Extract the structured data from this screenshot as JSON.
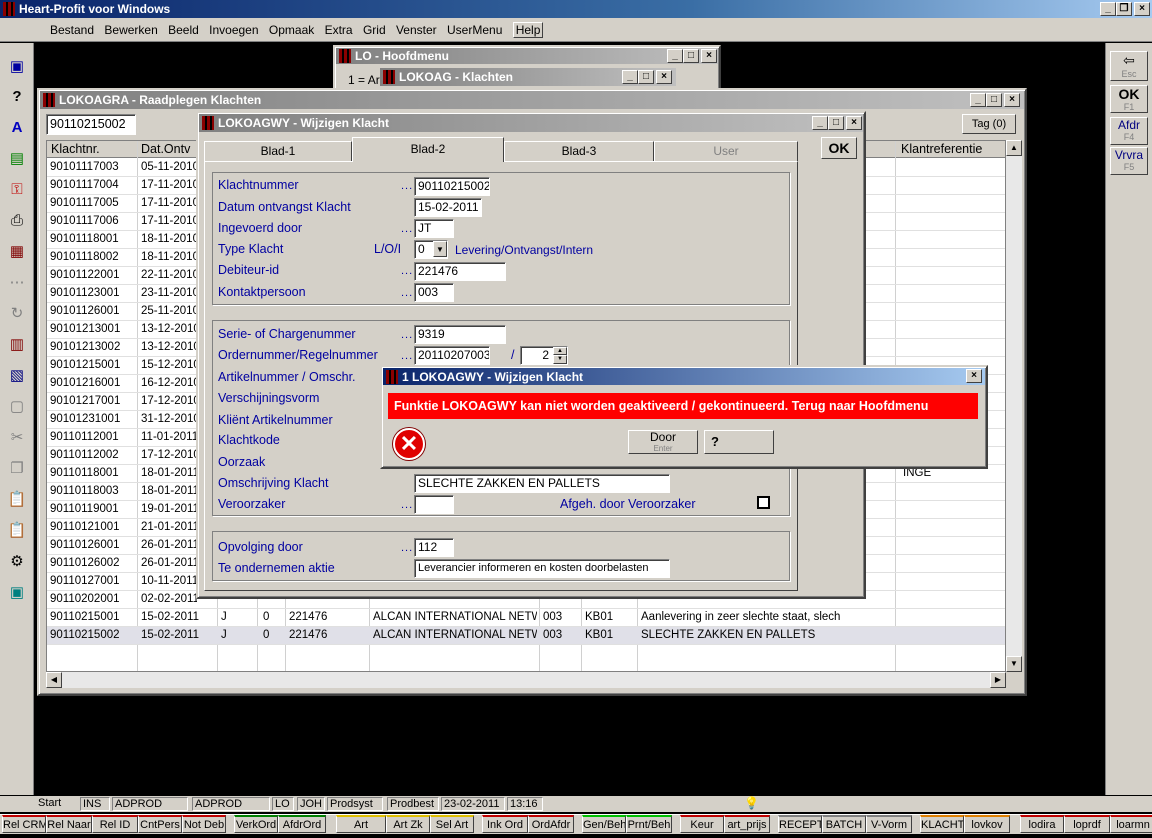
{
  "app": {
    "title": "Heart-Profit voor Windows"
  },
  "menu": [
    "Bestand",
    "Bewerken",
    "Beeld",
    "Invoegen",
    "Opmaak",
    "Extra",
    "Grid",
    "Venster",
    "UserMenu",
    "Help"
  ],
  "right_toolbar": {
    "esc": "Esc",
    "ok": "OK",
    "ok_key": "F1",
    "afdr": "Afdr",
    "afdr_key": "F4",
    "vrvra": "Vrvra",
    "vrvra_key": "F5"
  },
  "hoofdmenu": {
    "title": "LO - Hoofdmenu",
    "line": "1 = Ar"
  },
  "klachten_win": {
    "title": "LOKOAG - Klachten"
  },
  "raadplegen": {
    "title": "LOKOAGRA - Raadplegen Klachten",
    "search_value": "90110215002",
    "tag_button": "Tag (0)",
    "columns": [
      "Klachtnr.",
      "Dat.Ontv",
      "Klantreferentie"
    ],
    "rows": [
      [
        "90101117003",
        "05-11-2010"
      ],
      [
        "90101117004",
        "17-11-2010"
      ],
      [
        "90101117005",
        "17-11-2010"
      ],
      [
        "90101117006",
        "17-11-2010"
      ],
      [
        "90101118001",
        "18-11-2010"
      ],
      [
        "90101118002",
        "18-11-2010"
      ],
      [
        "90101122001",
        "22-11-2010"
      ],
      [
        "90101123001",
        "23-11-2010"
      ],
      [
        "90101126001",
        "25-11-2010"
      ],
      [
        "90101213001",
        "13-12-2010"
      ],
      [
        "90101213002",
        "13-12-2010"
      ],
      [
        "90101215001",
        "15-12-2010"
      ],
      [
        "90101216001",
        "16-12-2010"
      ],
      [
        "90101217001",
        "17-12-2010"
      ],
      [
        "90101231001",
        "31-12-2010"
      ],
      [
        "90110112001",
        "11-01-2011"
      ],
      [
        "90110112002",
        "17-12-2010"
      ],
      [
        "90110118001",
        "18-01-2011"
      ],
      [
        "90110118003",
        "18-01-2011"
      ],
      [
        "90110119001",
        "19-01-2011"
      ],
      [
        "90110121001",
        "21-01-2011"
      ],
      [
        "90110126001",
        "26-01-2011"
      ],
      [
        "90110126002",
        "26-01-2011"
      ],
      [
        "90110127001",
        "10-11-2011"
      ],
      [
        "90110202001",
        "02-02-2011"
      ]
    ],
    "full_rows": [
      {
        "nr": "90110215001",
        "date": "15-02-2011",
        "j": "J",
        "o": "0",
        "deb": "221476",
        "name": "ALCAN INTERNATIONAL NETWO",
        "cp": "003",
        "kode": "KB01",
        "oms": "Aanlevering in zeer slechte staat, slech"
      },
      {
        "nr": "90110215002",
        "date": "15-02-2011",
        "j": "J",
        "o": "0",
        "deb": "221476",
        "name": "ALCAN INTERNATIONAL NETWO",
        "cp": "003",
        "kode": "KB01",
        "oms": "SLECHTE ZAKKEN EN PALLETS"
      }
    ],
    "partial_ref": "INGE"
  },
  "wijzigen": {
    "title": "LOKOAGWY - Wijzigen Klacht",
    "ok": "OK",
    "tabs": [
      "Blad-1",
      "Blad-2",
      "Blad-3",
      "User"
    ],
    "labels": {
      "klachtnummer": "Klachtnummer",
      "datum": "Datum ontvangst Klacht",
      "ingevoerd": "Ingevoerd door",
      "type": "Type Klacht",
      "type_code": "L/O/I",
      "debiteur": "Debiteur-id",
      "kontakt": "Kontaktpersoon",
      "serie": "Serie- of Chargenummer",
      "order": "Ordernummer/Regelnummer",
      "artikel": "Artikelnummer / Omschr.",
      "verschijning": "Verschijningsvorm",
      "klient": "Kliënt Artikelnummer",
      "klachtkode": "Klachtkode",
      "oorzaak": "Oorzaak",
      "omschrijving": "Omschrijving Klacht",
      "veroorzaker": "Veroorzaker",
      "afgeh": "Afgeh. door Veroorzaker",
      "opvolging": "Opvolging door",
      "aktie": "Te ondernemen aktie",
      "type_desc": "Levering/Ontvangst/Intern",
      "slash": "/"
    },
    "values": {
      "klachtnummer": "90110215002",
      "datum": "15-02-2011",
      "ingevoerd": "JT",
      "type": "0",
      "debiteur": "221476",
      "kontakt": "003",
      "serie": "9319",
      "order": "20110207003",
      "regel": "2",
      "omschrijving": "SLECHTE ZAKKEN EN PALLETS",
      "veroorzaker": "",
      "opvolging": "112",
      "aktie": "Leverancier informeren en kosten doorbelasten"
    }
  },
  "dialog": {
    "title": "1 LOKOAGWY - Wijzigen Klacht",
    "message": "Funktie LOKOAGWY kan niet worden geaktiveerd / gekontinueerd.  Terug naar Hoofdmenu",
    "door": "Door",
    "door_key": "Enter",
    "help_glyph": "?"
  },
  "status": [
    "Start",
    "INS",
    "ADPROD",
    "ADPROD",
    "LO",
    "JOH",
    "Prodsyst",
    "Prodbest",
    "23-02-2011",
    "13:16"
  ],
  "taskbar": [
    "Rel CRM",
    "Rel Naar",
    "Rel ID",
    "CntPers",
    "Not Deb",
    "VerkOrd",
    "AfdrOrd",
    "Art",
    "Art Zk",
    "Sel Art",
    "Ink Ord",
    "OrdAfdr",
    "Gen/Beh",
    "Prnt/Beh",
    "Keur",
    "art_prijs",
    "RECEPT",
    "BATCH",
    "V-Vorm",
    "KLACHT",
    "lovkov",
    "lodira",
    "loprdf",
    "loarmn"
  ]
}
